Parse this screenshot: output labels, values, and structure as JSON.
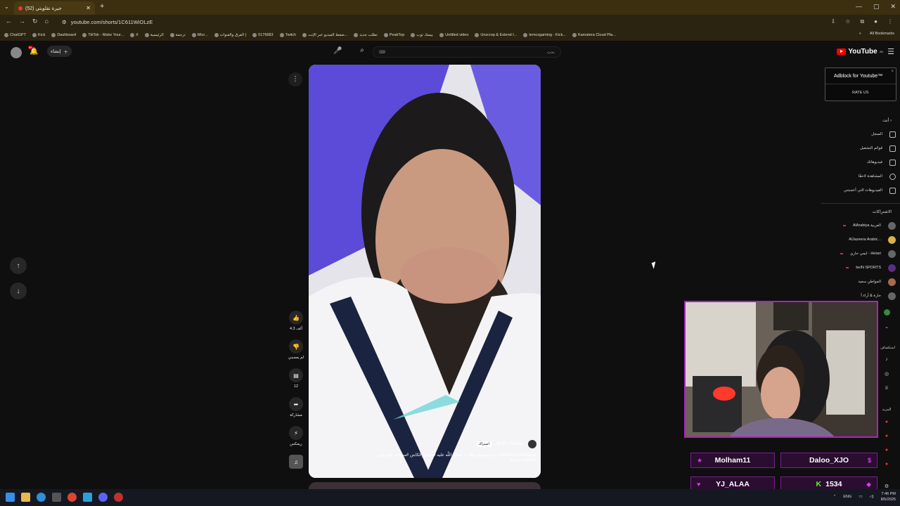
{
  "browser": {
    "tab_title": "جيرة نقلوبتي (52)",
    "url": "youtube.com/shorts/1C611WiOLzE",
    "bookmarks": [
      "ChatGPT",
      "Kick",
      "Dashboard",
      "TikTok - Make Your...",
      "X",
      "الرئيسية",
      "ترجمة",
      "Micr...",
      "الفرق والقنوات |",
      "0176683",
      "Twitch",
      "ضغط الفيديو عبر الإنت...",
      "تطلب جديد",
      "PeakTop",
      "بيسك توب",
      "Untitled video",
      "Unscrop & Extend I...",
      "temcxgaming - Kick...",
      "Kamatera Cloud Pla..."
    ],
    "all_bookmarks": "All Bookmarks"
  },
  "youtube": {
    "create_label": "إنشاء",
    "notif_count": "9+",
    "search_placeholder": "بحث",
    "search_hint": "⌨",
    "logo_text": "YouTube",
    "logo_region": "JO"
  },
  "short": {
    "channel": "@AR_Shaikso",
    "subscribe_label": "اشتراك",
    "caption_line1": "جيرة نقلوبتي 😂 ١٠ شتاك اللّه عليه #تحدي_الكابتن #مساعد_القيزوان #football #challenge",
    "caption_line2": "#تحدي #shorts",
    "like_count": "4.3 ألف",
    "dislike_label": "لم يعجبني",
    "comments_count": "12",
    "share_label": "مشاركة",
    "remix_label": "ريمكس"
  },
  "adblock": {
    "title": "Adblock for Youtube™",
    "rate": "RATE US",
    "close": "×"
  },
  "sidebar": {
    "you_header": "أنت",
    "you_items": [
      "السجل",
      "قوائم التشغيل",
      "فيديوهاتك",
      "المشاهدة لاحقًا",
      "الفيديوهات التي أعجبتني"
    ],
    "subs_header": "الاشتراكات",
    "subs": [
      "AlArabiya العربية",
      "AlJazeera Arabic...",
      "ايمي حاري - Hetari",
      "beIN SPORTS",
      "المواطن سعيد",
      "حارة & آراء آ"
    ],
    "explore_header": "استكشاف",
    "more_header": "المزيد"
  },
  "overlay": {
    "user1": "Molham11",
    "user2": "Daloo_XJO",
    "user3": "YJ_ALAA",
    "kick_count": "1534"
  },
  "taskbar": {
    "lang": "ENG",
    "time": "7:46 PM",
    "date": "8/5/2025"
  },
  "colors": {
    "overlay_border": "#b020c0",
    "kick_green": "#52fc18",
    "yt_red": "#ff0000"
  }
}
